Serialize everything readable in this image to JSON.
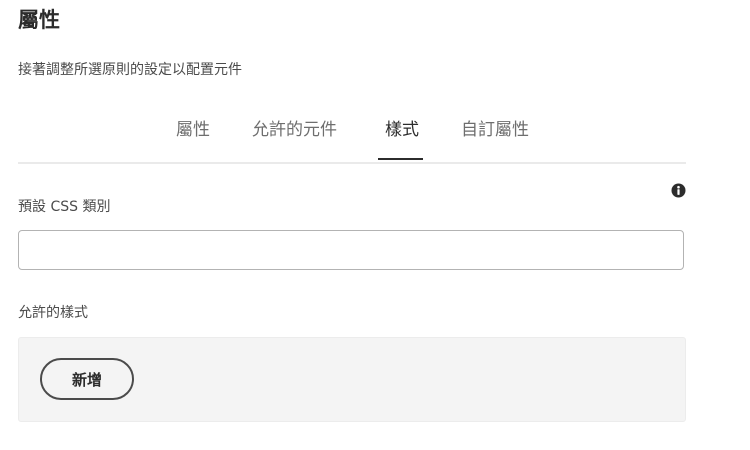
{
  "header": {
    "title": "屬性",
    "subtitle": "接著調整所選原則的設定以配置元件"
  },
  "tabs": [
    {
      "label": "屬性",
      "active": false
    },
    {
      "label": "允許的元件",
      "active": false
    },
    {
      "label": "樣式",
      "active": true
    },
    {
      "label": "自訂屬性",
      "active": false
    }
  ],
  "default_css_class": {
    "label": "預設 CSS 類別",
    "value": "",
    "info_icon": "info-icon"
  },
  "allowed_styles": {
    "label": "允許的樣式",
    "add_button_label": "新增"
  },
  "colors": {
    "text": "#2c2c2c",
    "muted_text": "#6e6e6e",
    "panel_bg": "#f4f4f4",
    "active_tab_underline": "#2c2c2c"
  }
}
